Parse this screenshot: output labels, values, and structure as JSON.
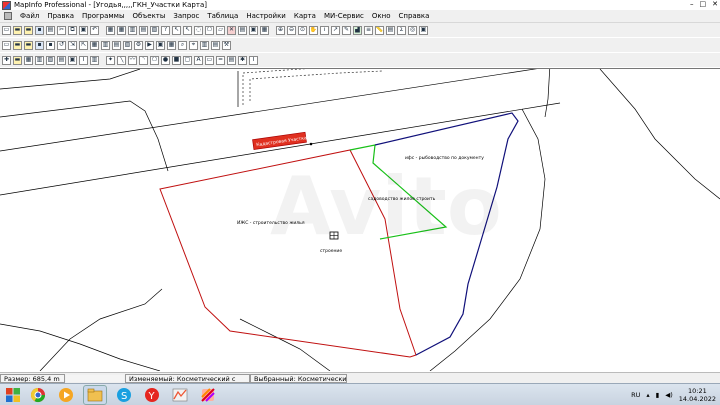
{
  "window": {
    "title": "MapInfo Professional - [Угодья,,,,,ГКН_Участки Карта]"
  },
  "menu": [
    "Файл",
    "Правка",
    "Программы",
    "Объекты",
    "Запрос",
    "Таблица",
    "Настройки",
    "Карта",
    "МИ-Сервис",
    "Окно",
    "Справка"
  ],
  "map": {
    "label_cadastre": "Кадастровая Участка",
    "label_izhs": "ИЖС - строительство жилья",
    "label_sad": "садоводство жилое строить",
    "label_lph": "ифс - рыбоводство по документу",
    "label_building": "строение"
  },
  "status": {
    "size": "Размер: 685,4 m",
    "editable": "Изменяемый: Косметический с",
    "selected": "Выбранный: Косметический сло"
  },
  "taskbar": {
    "lang": "RU",
    "time": "10:21",
    "date": "14.04.2022"
  },
  "colors": {
    "parcel_red": "#c01010",
    "parcel_green": "#18c018",
    "parcel_navy": "#10107a",
    "map_lines": "#000000"
  }
}
